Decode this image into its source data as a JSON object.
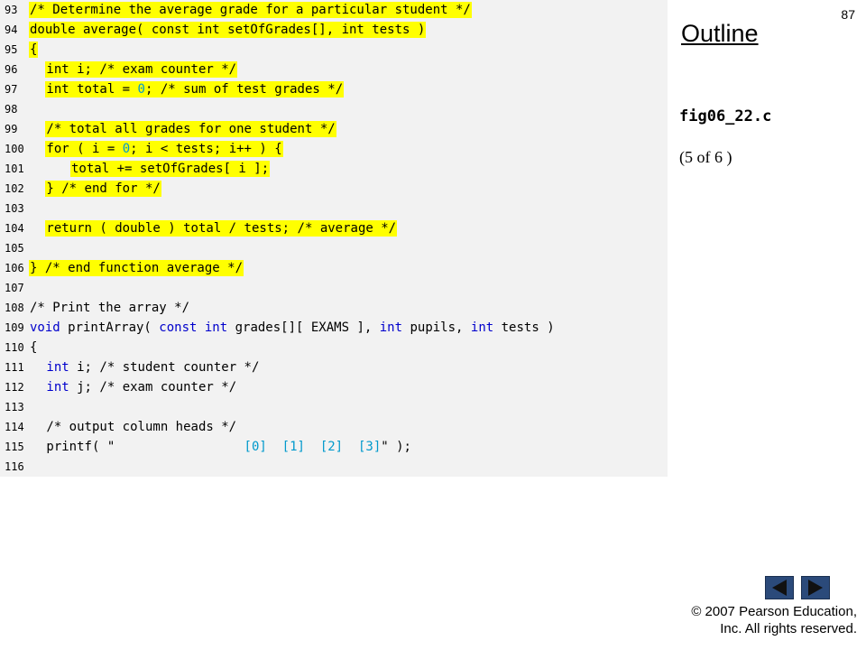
{
  "page_number": "87",
  "outline_title": "Outline",
  "filename": "fig06_22.c",
  "page_info": "(5 of 6 )",
  "copyright": {
    "line1": "© 2007 Pearson Education,",
    "line2": "Inc.  All rights reserved."
  },
  "code_lines": [
    {
      "n": "93",
      "highlight": true,
      "indent": 0,
      "segs": [
        {
          "t": "/* Determine the average grade for a particular student */",
          "c": "txt"
        }
      ]
    },
    {
      "n": "94",
      "highlight": true,
      "indent": 0,
      "segs": [
        {
          "t": "double average( const int setOfGrades[], int tests )",
          "c": "txt"
        }
      ]
    },
    {
      "n": "95",
      "highlight": true,
      "indent": 0,
      "segs": [
        {
          "t": "{",
          "c": "txt"
        }
      ]
    },
    {
      "n": "96",
      "highlight": true,
      "indent": 2,
      "segs": [
        {
          "t": "int i; /* exam counter */",
          "c": "txt"
        }
      ]
    },
    {
      "n": "97",
      "highlight": true,
      "indent": 2,
      "segs": [
        {
          "t": "int total = ",
          "c": "txt"
        },
        {
          "t": "0",
          "c": "num"
        },
        {
          "t": "; /* sum of test grades */",
          "c": "txt"
        }
      ]
    },
    {
      "n": "98",
      "highlight": false,
      "indent": 0,
      "segs": []
    },
    {
      "n": "99",
      "highlight": true,
      "indent": 2,
      "segs": [
        {
          "t": "/* total all grades for one student */",
          "c": "txt"
        }
      ]
    },
    {
      "n": "100",
      "highlight": true,
      "indent": 2,
      "segs": [
        {
          "t": "for ( i = ",
          "c": "txt"
        },
        {
          "t": "0",
          "c": "num"
        },
        {
          "t": "; i < tests; i++ ) {",
          "c": "txt"
        }
      ]
    },
    {
      "n": "101",
      "highlight": true,
      "indent": 5,
      "segs": [
        {
          "t": "total += setOfGrades[ i ];",
          "c": "txt"
        }
      ]
    },
    {
      "n": "102",
      "highlight": true,
      "indent": 2,
      "segs": [
        {
          "t": "} /* end for */",
          "c": "txt"
        }
      ]
    },
    {
      "n": "103",
      "highlight": false,
      "indent": 0,
      "segs": []
    },
    {
      "n": "104",
      "highlight": true,
      "indent": 2,
      "segs": [
        {
          "t": "return ( double ) total / tests; /* average */",
          "c": "txt"
        }
      ]
    },
    {
      "n": "105",
      "highlight": false,
      "indent": 0,
      "segs": []
    },
    {
      "n": "106",
      "highlight": true,
      "indent": 0,
      "segs": [
        {
          "t": "} /* end function average */",
          "c": "txt"
        }
      ]
    },
    {
      "n": "107",
      "highlight": false,
      "indent": 0,
      "segs": []
    },
    {
      "n": "108",
      "highlight": false,
      "indent": 0,
      "segs": [
        {
          "t": "/* Print the array */",
          "c": "txt"
        }
      ]
    },
    {
      "n": "109",
      "highlight": false,
      "indent": 0,
      "segs": [
        {
          "t": "void",
          "c": "kw"
        },
        {
          "t": " printArray( ",
          "c": "txt"
        },
        {
          "t": "const int",
          "c": "kw"
        },
        {
          "t": " grades[][ EXAMS ], ",
          "c": "txt"
        },
        {
          "t": "int",
          "c": "kw"
        },
        {
          "t": " pupils, ",
          "c": "txt"
        },
        {
          "t": "int",
          "c": "kw"
        },
        {
          "t": " tests )",
          "c": "txt"
        }
      ]
    },
    {
      "n": "110",
      "highlight": false,
      "indent": 0,
      "segs": [
        {
          "t": "{",
          "c": "txt"
        }
      ]
    },
    {
      "n": "111",
      "highlight": false,
      "indent": 2,
      "segs": [
        {
          "t": "int",
          "c": "kw"
        },
        {
          "t": " i; /* student counter */",
          "c": "txt"
        }
      ]
    },
    {
      "n": "112",
      "highlight": false,
      "indent": 2,
      "segs": [
        {
          "t": "int",
          "c": "kw"
        },
        {
          "t": " j; /* exam counter */",
          "c": "txt"
        }
      ]
    },
    {
      "n": "113",
      "highlight": false,
      "indent": 0,
      "segs": []
    },
    {
      "n": "114",
      "highlight": false,
      "indent": 2,
      "segs": [
        {
          "t": "/* output column heads */",
          "c": "txt"
        }
      ]
    },
    {
      "n": "115",
      "highlight": false,
      "indent": 2,
      "segs": [
        {
          "t": "printf( \"",
          "c": "txt"
        },
        {
          "t": "                 [0]  [1]  [2]  [3]",
          "c": "num"
        },
        {
          "t": "\" );",
          "c": "txt"
        }
      ]
    },
    {
      "n": "116",
      "highlight": false,
      "indent": 0,
      "segs": []
    }
  ]
}
